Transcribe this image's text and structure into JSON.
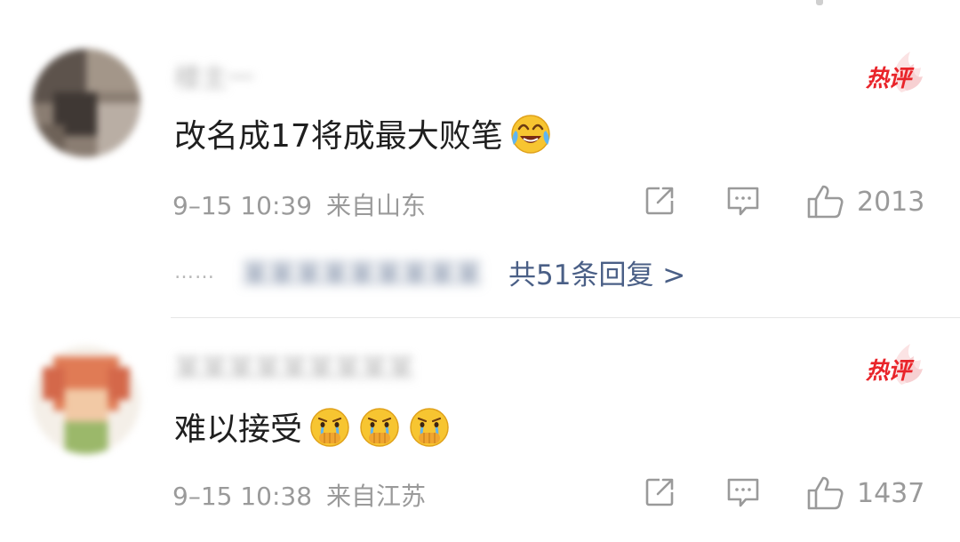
{
  "comments": [
    {
      "username": "楼主一",
      "badge": "热评",
      "text": "改名成17将成最大败笔",
      "emojis": [
        "laughing-crying-emoji"
      ],
      "time": "9–15 10:39",
      "location": "来自山东",
      "likes": "2013",
      "reply_dots": "……",
      "reply_names": "某某某某某某某某某",
      "reply_link": "共51条回复 >"
    },
    {
      "username": "某某某某某某某某某",
      "badge": "热评",
      "text": "难以接受",
      "emojis": [
        "crying-emoji",
        "crying-emoji",
        "crying-emoji"
      ],
      "time": "9–15 10:38",
      "location": "来自江苏",
      "likes": "1437"
    }
  ],
  "colors": {
    "badge_red": "#e9242a",
    "meta_gray": "#9a9a9a",
    "link_blue": "#4a5f86",
    "text": "#1f1f1f"
  }
}
